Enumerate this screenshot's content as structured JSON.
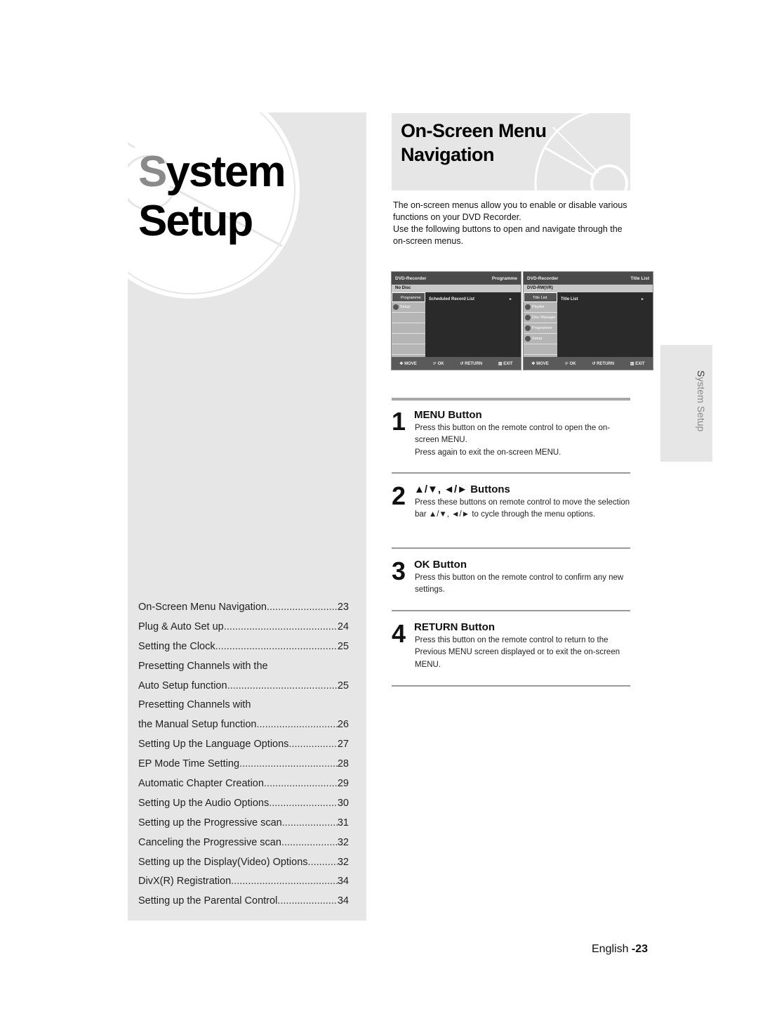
{
  "section": {
    "title_line1_first": "S",
    "title_line1_rest": "ystem",
    "title_line2": "Setup"
  },
  "toc": [
    {
      "label": "On-Screen Menu Navigation",
      "page": "23"
    },
    {
      "label": "Plug & Auto Set up",
      "page": "24"
    },
    {
      "label": "Setting the Clock",
      "page": "25"
    },
    {
      "label": "Presetting Channels with the",
      "page": ""
    },
    {
      "label": "Auto Setup function",
      "page": "25"
    },
    {
      "label": "Presetting Channels with",
      "page": ""
    },
    {
      "label": "the Manual Setup function",
      "page": "26"
    },
    {
      "label": "Setting Up the Language Options",
      "page": "27"
    },
    {
      "label": "EP Mode Time Setting",
      "page": "28"
    },
    {
      "label": "Automatic Chapter Creation",
      "page": "29"
    },
    {
      "label": "Setting Up the Audio Options",
      "page": "30"
    },
    {
      "label": "Setting up the Progressive scan",
      "page": "31"
    },
    {
      "label": "Canceling the Progressive scan",
      "page": "32"
    },
    {
      "label": "Setting up the Display(Video) Options",
      "page": "32"
    },
    {
      "label": "DivX(R) Registration",
      "page": "34"
    },
    {
      "label": "Setting up the Parental Control",
      "page": "34"
    }
  ],
  "page": {
    "title_line1": "On-Screen Menu",
    "title_line2": "Navigation",
    "intro_p1": "The on-screen menus allow you to enable or disable various functions on your DVD Recorder.",
    "intro_p2": "Use the following buttons to open and navigate through the on-screen menus."
  },
  "osd_screens": [
    {
      "header_left": "DVD-Recorder",
      "header_right": "Programme",
      "disc": "No Disc",
      "side_items": [
        "Programme",
        "Setup",
        "",
        "",
        "",
        ""
      ],
      "selected_index": 0,
      "main_item": "Scheduled Record List",
      "arrow": "►",
      "footer": [
        "MOVE",
        "OK",
        "RETURN",
        "EXIT"
      ]
    },
    {
      "header_left": "DVD-Recorder",
      "header_right": "Title List",
      "disc": "DVD-RW(VR)",
      "side_items": [
        "Title List",
        "Playlist",
        "Disc Manager",
        "Programme",
        "Setup",
        ""
      ],
      "selected_index": 0,
      "main_item": "Title List",
      "arrow": "►",
      "footer": [
        "MOVE",
        "OK",
        "RETURN",
        "EXIT"
      ]
    }
  ],
  "steps": [
    {
      "number": "1",
      "title": "MENU Button",
      "desc": "Press this button on the remote control to open the on-screen MENU.",
      "desc2": "Press again to exit the on-screen MENU."
    },
    {
      "number": "2",
      "title": "▲/▼, ◄/► Buttons",
      "desc": "Press these buttons on remote control to move the selection bar ▲/▼, ◄/► to cycle through the menu options.",
      "desc2": ""
    },
    {
      "number": "3",
      "title": "OK Button",
      "desc": "Press this button on the remote control to confirm any new settings.",
      "desc2": ""
    },
    {
      "number": "4",
      "title": "RETURN Button",
      "desc": "Press this button on the remote control to return to the Previous MENU screen displayed or to exit the on-screen MENU.",
      "desc2": ""
    }
  ],
  "side_tab": {
    "first": "S",
    "rest": "ystem Setup"
  },
  "footer": {
    "language": "English ",
    "page": "-23"
  },
  "colors": {
    "panel_gray": "#e6e6e6",
    "accent_gray": "#8a8a8a"
  }
}
